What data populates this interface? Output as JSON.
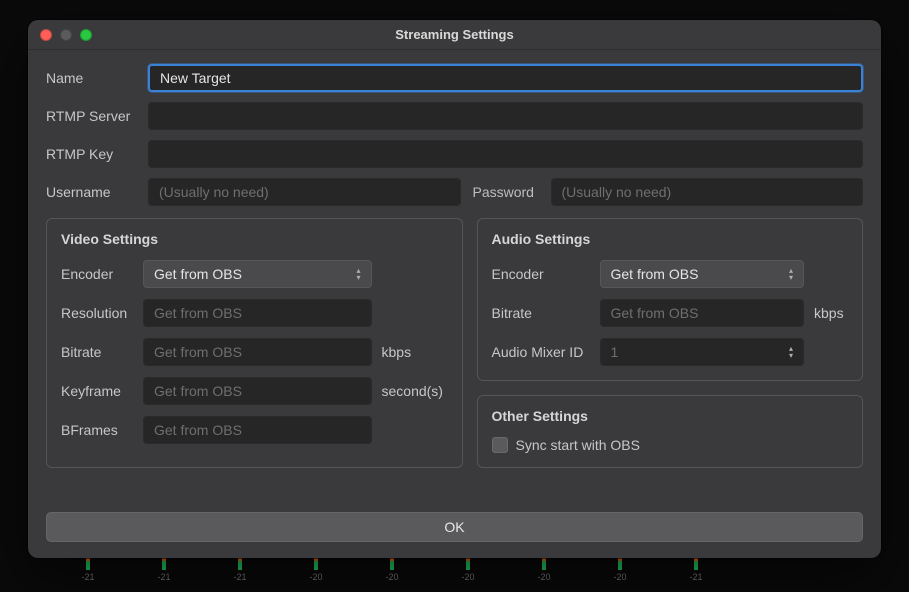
{
  "dialog": {
    "title": "Streaming Settings",
    "fields": {
      "name_label": "Name",
      "name_value": "New Target",
      "rtmp_server_label": "RTMP Server",
      "rtmp_server_value": "",
      "rtmp_key_label": "RTMP Key",
      "rtmp_key_value": "",
      "username_label": "Username",
      "username_placeholder": "(Usually no need)",
      "password_label": "Password",
      "password_placeholder": "(Usually no need)"
    },
    "video": {
      "title": "Video Settings",
      "encoder_label": "Encoder",
      "encoder_value": "Get from OBS",
      "resolution_label": "Resolution",
      "resolution_placeholder": "Get from OBS",
      "bitrate_label": "Bitrate",
      "bitrate_placeholder": "Get from OBS",
      "bitrate_unit": "kbps",
      "keyframe_label": "Keyframe",
      "keyframe_placeholder": "Get from OBS",
      "keyframe_unit": "second(s)",
      "bframes_label": "BFrames",
      "bframes_placeholder": "Get from OBS"
    },
    "audio": {
      "title": "Audio Settings",
      "encoder_label": "Encoder",
      "encoder_value": "Get from OBS",
      "bitrate_label": "Bitrate",
      "bitrate_placeholder": "Get from OBS",
      "bitrate_unit": "kbps",
      "mixer_label": "Audio Mixer ID",
      "mixer_value": "1"
    },
    "other": {
      "title": "Other Settings",
      "sync_label": "Sync start with OBS",
      "sync_checked": false
    },
    "ok_label": "OK"
  },
  "bg_meters": [
    "-21",
    "-21",
    "-21",
    "-20",
    "-20",
    "-20",
    "-20",
    "-20",
    "-21"
  ]
}
